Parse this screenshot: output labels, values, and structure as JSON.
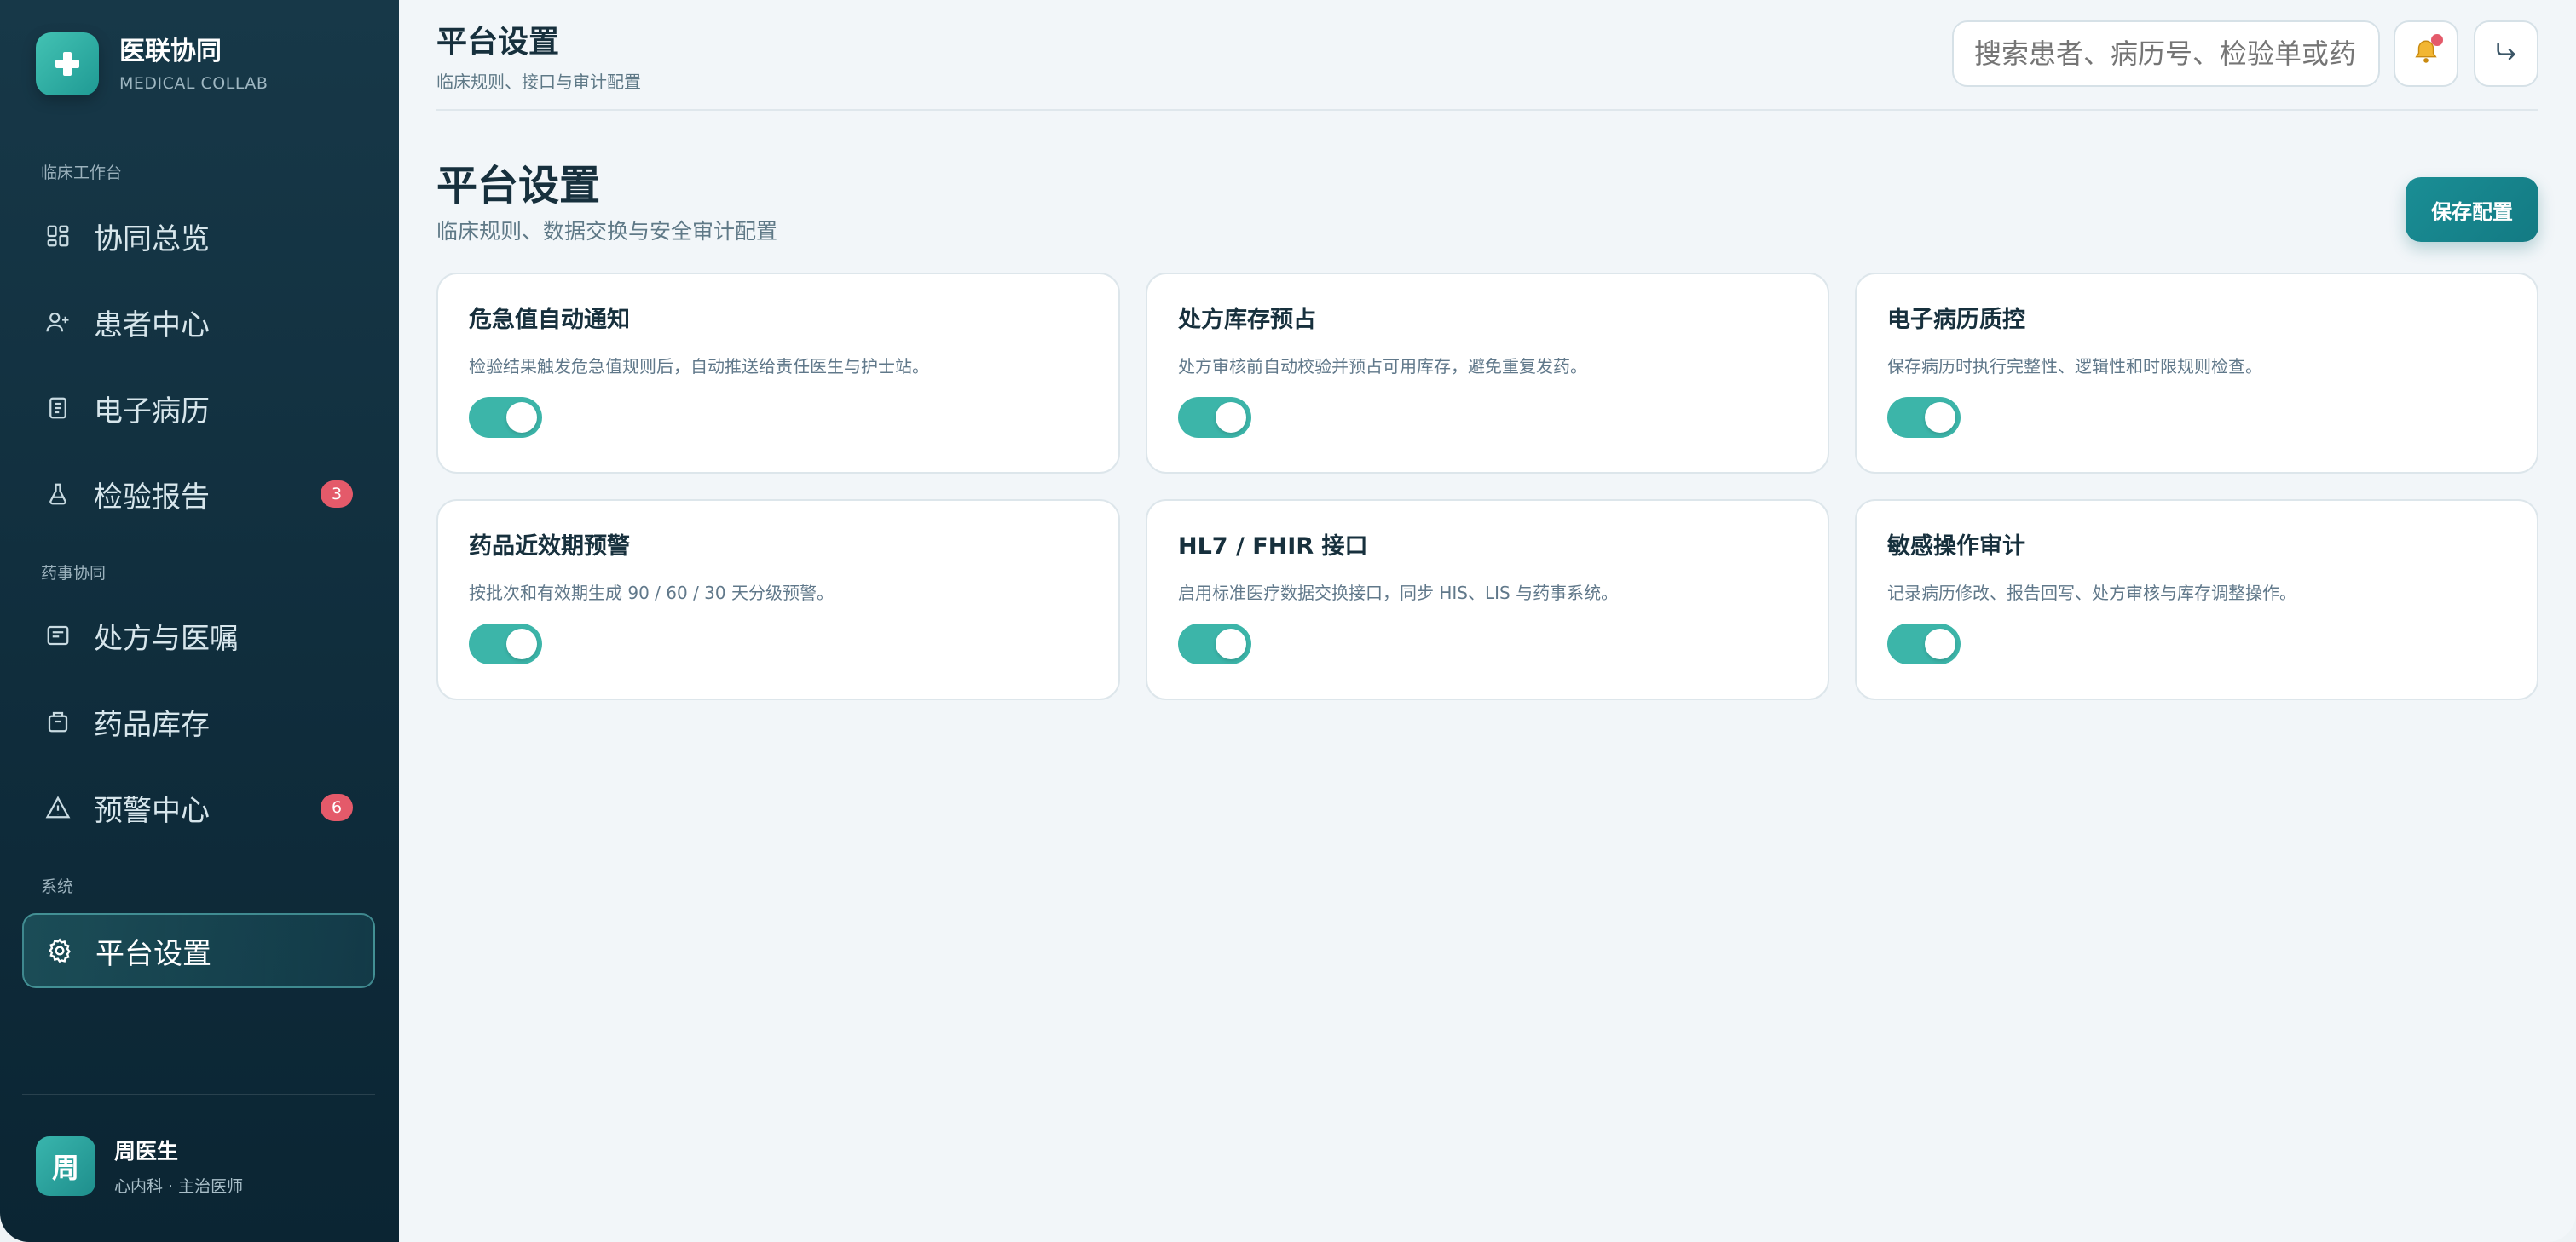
{
  "brand": {
    "name": "医联协同",
    "subtitle": "MEDICAL COLLAB"
  },
  "sidebar": {
    "sections": [
      {
        "label": "临床工作台"
      },
      {
        "label": "药事协同"
      },
      {
        "label": "系统"
      }
    ],
    "items": [
      {
        "label": "协同总览",
        "icon": "dashboard-icon"
      },
      {
        "label": "患者中心",
        "icon": "user-plus-icon"
      },
      {
        "label": "电子病历",
        "icon": "document-icon"
      },
      {
        "label": "检验报告",
        "icon": "flask-icon",
        "badge": "3"
      },
      {
        "label": "处方与医嘱",
        "icon": "prescription-icon"
      },
      {
        "label": "药品库存",
        "icon": "inventory-icon"
      },
      {
        "label": "预警中心",
        "icon": "warning-icon",
        "badge": "6"
      },
      {
        "label": "平台设置",
        "icon": "gear-icon",
        "active": true
      }
    ]
  },
  "user": {
    "avatar": "周",
    "name": "周医生",
    "role": "心内科 · 主治医师"
  },
  "header": {
    "title": "平台设置",
    "subtitle": "临床规则、接口与审计配置",
    "search_placeholder": "搜索患者、病历号、检验单或药"
  },
  "page": {
    "title": "平台设置",
    "subtitle": "临床规则、数据交换与安全审计配置",
    "save_label": "保存配置"
  },
  "settings": [
    {
      "title": "危急值自动通知",
      "desc": "检验结果触发危急值规则后，自动推送给责任医生与护士站。",
      "enabled": true
    },
    {
      "title": "处方库存预占",
      "desc": "处方审核前自动校验并预占可用库存，避免重复发药。",
      "enabled": true
    },
    {
      "title": "电子病历质控",
      "desc": "保存病历时执行完整性、逻辑性和时限规则检查。",
      "enabled": true
    },
    {
      "title": "药品近效期预警",
      "desc": "按批次和有效期生成 90 / 60 / 30 天分级预警。",
      "enabled": true
    },
    {
      "title": "HL7 / FHIR 接口",
      "desc": "启用标准医疗数据交换接口，同步 HIS、LIS 与药事系统。",
      "enabled": true
    },
    {
      "title": "敏感操作审计",
      "desc": "记录病历修改、报告回写、处方审核与库存调整操作。",
      "enabled": true
    }
  ],
  "colors": {
    "accent": "#3cb5a9",
    "badge": "#e45a6a",
    "sidebar_bg": "#10303f"
  }
}
